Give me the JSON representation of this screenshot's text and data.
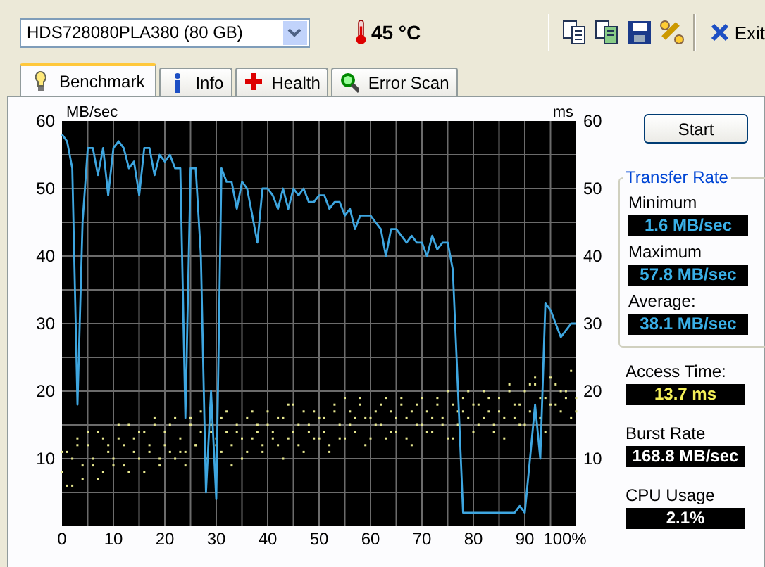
{
  "drive_selector": {
    "value": "HDS728080PLA380 (80 GB)"
  },
  "temperature": "45 °C",
  "exit_button": {
    "label": "Exit"
  },
  "tabs": [
    {
      "label": "Benchmark",
      "kind": "bulb",
      "selected": true
    },
    {
      "label": "Info",
      "kind": "info",
      "selected": false
    },
    {
      "label": "Health",
      "kind": "health",
      "selected": false
    },
    {
      "label": "Error Scan",
      "kind": "scan",
      "selected": false
    }
  ],
  "chart": {
    "chart_data": {
      "type": "line",
      "grid": true,
      "ylabel": "MB/sec",
      "xlim": [
        0,
        100
      ],
      "ylim": [
        0,
        60
      ],
      "xticks": [
        {
          "value": 0,
          "label": "0"
        },
        {
          "value": 10,
          "label": "10"
        },
        {
          "value": 20,
          "label": "20"
        },
        {
          "value": 30,
          "label": "30"
        },
        {
          "value": 40,
          "label": "40"
        },
        {
          "value": 50,
          "label": "50"
        },
        {
          "value": 60,
          "label": "60"
        },
        {
          "value": 70,
          "label": "70"
        },
        {
          "value": 80,
          "label": "80"
        },
        {
          "value": 90,
          "label": "90"
        },
        {
          "value": 100,
          "label": "100%"
        }
      ],
      "yticks": [
        10,
        20,
        30,
        40,
        50,
        60
      ],
      "x": [
        0,
        1,
        2,
        3,
        4,
        5,
        6,
        7,
        8,
        9,
        10,
        11,
        12,
        13,
        14,
        15,
        16,
        17,
        18,
        19,
        20,
        21,
        22,
        23,
        24,
        25,
        26,
        27,
        28,
        29,
        30,
        31,
        32,
        33,
        34,
        35,
        36,
        37,
        38,
        39,
        40,
        41,
        42,
        43,
        44,
        45,
        46,
        47,
        48,
        49,
        50,
        51,
        52,
        53,
        54,
        55,
        56,
        57,
        58,
        59,
        60,
        61,
        62,
        63,
        64,
        65,
        66,
        67,
        68,
        69,
        70,
        71,
        72,
        73,
        74,
        75,
        76,
        77,
        78,
        79,
        80,
        81,
        82,
        83,
        84,
        85,
        86,
        87,
        88,
        89,
        90,
        91,
        92,
        93,
        94,
        95,
        96,
        97,
        98,
        99,
        100
      ],
      "series": [
        {
          "type": "scatter",
          "color": "#e8e890",
          "values": [
            8,
            11,
            6,
            12,
            9,
            14,
            10,
            7,
            13,
            11,
            9,
            15,
            12,
            8,
            13,
            10,
            14,
            11,
            16,
            9,
            12,
            15,
            10,
            13,
            11,
            16,
            12,
            14,
            null,
            15,
            13,
            11,
            17,
            12,
            14,
            10,
            16,
            13,
            15,
            11,
            17,
            14,
            12,
            16,
            13,
            18,
            15,
            11,
            14,
            17,
            13,
            16,
            12,
            18,
            15,
            13,
            17,
            14,
            19,
            12,
            16,
            15,
            18,
            13,
            17,
            14,
            19,
            16,
            12,
            18,
            15,
            17,
            14,
            19,
            16,
            13,
            18,
            15,
            17,
            20,
            14,
            18,
            16,
            19,
            15,
            17,
            13,
            20,
            16,
            18,
            15,
            21,
            21,
            19,
            14,
            22,
            18,
            20,
            19,
            16,
            17
          ]
        },
        {
          "type": "scatter",
          "color": "#e8e890",
          "values": [
            11,
            6,
            10,
            13,
            7,
            12,
            9,
            14,
            8,
            12,
            10,
            13,
            9,
            15,
            11,
            14,
            8,
            12,
            15,
            10,
            14,
            11,
            16,
            11,
            9,
            15,
            12,
            17,
            10,
            14,
            12,
            16,
            14,
            9,
            15,
            13,
            11,
            17,
            14,
            12,
            15,
            13,
            16,
            10,
            18,
            14,
            12,
            17,
            15,
            13,
            16,
            14,
            11,
            17,
            13,
            19,
            15,
            16,
            18,
            16,
            13,
            17,
            15,
            19,
            14,
            16,
            18,
            13,
            17,
            15,
            19,
            14,
            16,
            18,
            15,
            20,
            13,
            17,
            19,
            16,
            18,
            15,
            20,
            17,
            14,
            19,
            16,
            21,
            18,
            15,
            20,
            17,
            22,
            16,
            19,
            18,
            21,
            17,
            20,
            23,
            19
          ]
        },
        {
          "color": "#3ea6e0",
          "values": [
            58,
            57,
            53,
            18,
            45,
            56,
            56,
            52,
            56,
            49,
            56,
            57,
            56,
            53,
            54,
            49,
            56,
            56,
            52,
            55,
            54,
            55,
            53,
            53,
            16,
            53,
            53,
            40,
            5,
            20,
            4,
            53,
            51,
            51,
            47,
            51,
            50,
            46,
            42,
            50,
            50,
            49,
            47,
            50,
            47,
            50,
            49,
            50,
            48,
            48,
            49,
            49,
            47,
            48,
            48,
            46,
            47,
            44,
            46,
            46,
            46,
            45,
            44,
            40,
            44,
            44,
            43,
            42,
            43,
            42,
            42,
            40,
            43,
            41,
            42,
            42,
            38,
            20,
            2,
            2,
            2,
            2,
            2,
            2,
            2,
            2,
            2,
            2,
            2,
            3,
            2,
            10,
            18,
            10,
            33,
            32,
            30,
            28,
            29,
            30,
            30
          ]
        }
      ]
    },
    "right_axis": {
      "label": "ms",
      "ticks": [
        "60",
        "50",
        "40",
        "30",
        "20",
        "10"
      ]
    }
  },
  "start_button": {
    "label": "Start"
  },
  "transfer_rate": {
    "title": "Transfer Rate",
    "readings": [
      {
        "label": "Minimum",
        "value": "1.6 MB/sec",
        "kind": "rate"
      },
      {
        "label": "Maximum",
        "value": "57.8 MB/sec",
        "kind": "rate"
      },
      {
        "label": "Average:",
        "value": "38.1 MB/sec",
        "kind": "rate"
      }
    ]
  },
  "other_readings": [
    {
      "label": "Access Time:",
      "value": "13.7 ms",
      "kind": "time"
    },
    {
      "label": "Burst Rate",
      "value": "168.8 MB/sec",
      "kind": "plain"
    },
    {
      "label": "CPU Usage",
      "value": "2.1%",
      "kind": "plain"
    }
  ]
}
